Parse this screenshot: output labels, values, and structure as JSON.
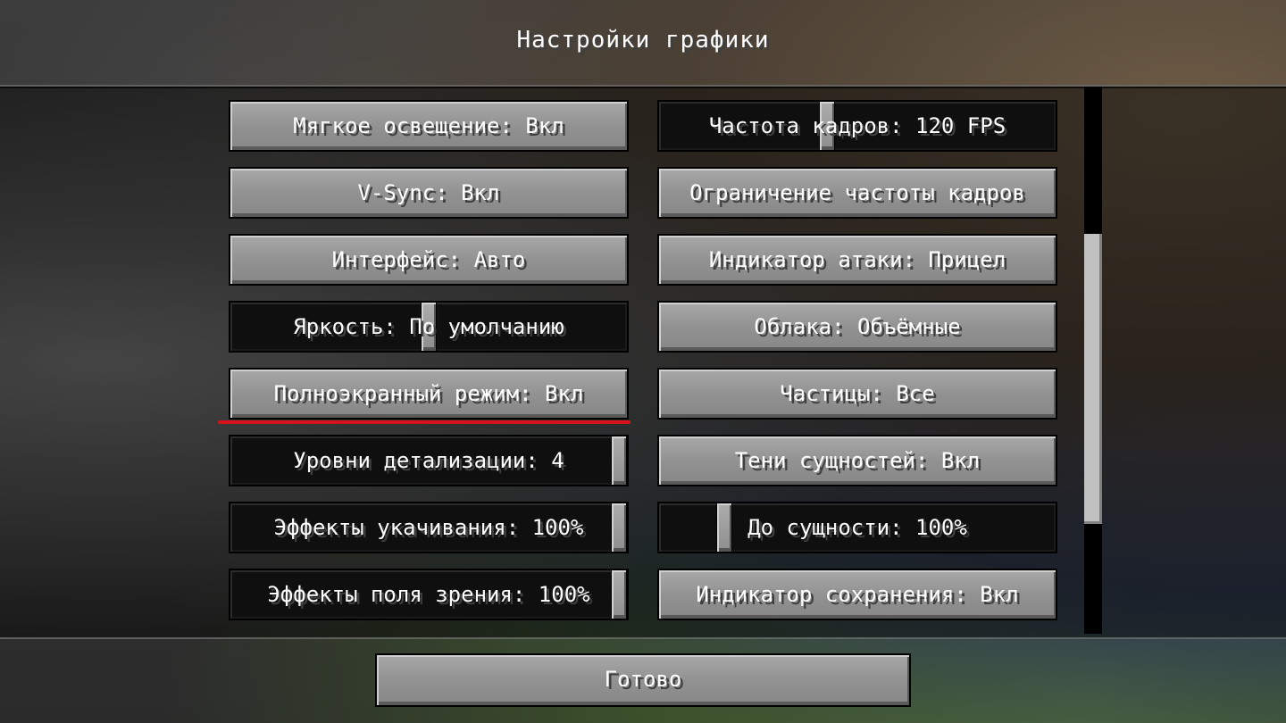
{
  "screen": {
    "title": "Настройки графики"
  },
  "options": {
    "left": [
      {
        "label": "Мягкое освещение: Вкл",
        "type": "button"
      },
      {
        "label": "V-Sync: Вкл",
        "type": "button"
      },
      {
        "label": "Интерфейс: Авто",
        "type": "button"
      },
      {
        "label": "Яркость: По умолчанию",
        "type": "slider",
        "value": 0.5
      },
      {
        "label": "Полноэкранный режим: Вкл",
        "type": "button"
      },
      {
        "label": "Уровни детализации: 4",
        "type": "slider",
        "value": 1.0
      },
      {
        "label": "Эффекты укачивания: 100%",
        "type": "slider",
        "value": 1.0
      },
      {
        "label": "Эффекты поля зрения: 100%",
        "type": "slider",
        "value": 1.0
      }
    ],
    "right": [
      {
        "label": "Частота кадров: 120 FPS",
        "type": "slider",
        "value": 0.42
      },
      {
        "label": "Ограничение частоты кадров",
        "type": "button"
      },
      {
        "label": "Индикатор атаки: Прицел",
        "type": "button"
      },
      {
        "label": "Облака: Объёмные",
        "type": "button"
      },
      {
        "label": "Частицы: Все",
        "type": "button"
      },
      {
        "label": "Тени сущностей: Вкл",
        "type": "button"
      },
      {
        "label": "До сущности: 100%",
        "type": "slider",
        "value": 0.15
      },
      {
        "label": "Индикатор сохранения: Вкл",
        "type": "button"
      }
    ]
  },
  "footer": {
    "done_label": "Готово"
  },
  "colors": {
    "highlight_underline": "#d8121b",
    "text": "#ffffff"
  }
}
